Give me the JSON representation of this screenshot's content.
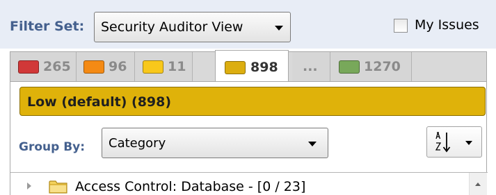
{
  "filter": {
    "label": "Filter Set:",
    "selected": "Security Auditor View",
    "my_issues_label": "My Issues",
    "my_issues_checked": false
  },
  "tabs": [
    {
      "count": "265",
      "color": "#d13838",
      "icon": "critical-swatch"
    },
    {
      "count": "96",
      "color": "#f48a14",
      "icon": "high-swatch"
    },
    {
      "count": "11",
      "color": "#f8c81b",
      "icon": "medium-swatch"
    },
    {
      "count": "898",
      "color": "#dcae10",
      "icon": "low-swatch",
      "active": true
    },
    {
      "count": "...",
      "color": null,
      "icon": null
    },
    {
      "count": "1270",
      "color": "#78a85a",
      "icon": "info-swatch"
    }
  ],
  "severity": {
    "label": "Low (default) (898)",
    "color": "#dfb20a"
  },
  "group_by": {
    "label": "Group By:",
    "selected": "Category"
  },
  "sort": {
    "icon": "sort-az-icon"
  },
  "tree": {
    "items": [
      {
        "label": "Access Control: Database - [0 / 23]",
        "icon": "folder-icon",
        "expanded": false
      }
    ]
  }
}
